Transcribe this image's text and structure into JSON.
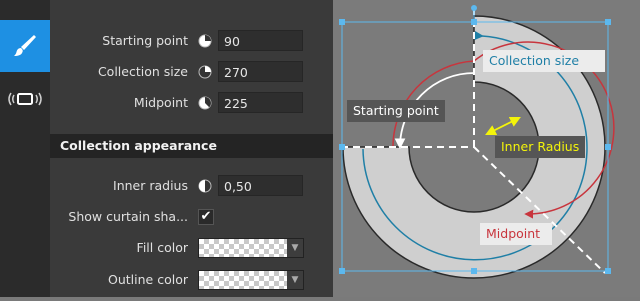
{
  "toolbar": {
    "items": [
      {
        "icon": "brush-icon",
        "active": true
      },
      {
        "icon": "broadcast-icon",
        "active": false
      }
    ]
  },
  "properties": {
    "starting_point": {
      "label": "Starting point",
      "value": "90"
    },
    "collection_size": {
      "label": "Collection size",
      "value": "270"
    },
    "midpoint": {
      "label": "Midpoint",
      "value": "225"
    }
  },
  "appearance": {
    "section_title": "Collection appearance",
    "inner_radius": {
      "label": "Inner radius",
      "value": "0,50"
    },
    "show_curtain": {
      "label": "Show curtain sha...",
      "checked": true
    },
    "fill_color": {
      "label": "Fill color"
    },
    "outline_color": {
      "label": "Outline color"
    }
  },
  "canvas": {
    "annotations": {
      "collection_size": "Collection size",
      "starting_point": "Starting point",
      "inner_radius": "Inner Radius",
      "midpoint": "Midpoint"
    },
    "colors": {
      "selection": "#5cb8ee",
      "ring_fill": "#cfcfcf",
      "arc_red": "#c8353d",
      "arc_blue": "#1f7fa6",
      "arrow_white": "#ffffff",
      "arrow_yellow": "#f4f40a",
      "dashed": "#ffffff"
    }
  }
}
